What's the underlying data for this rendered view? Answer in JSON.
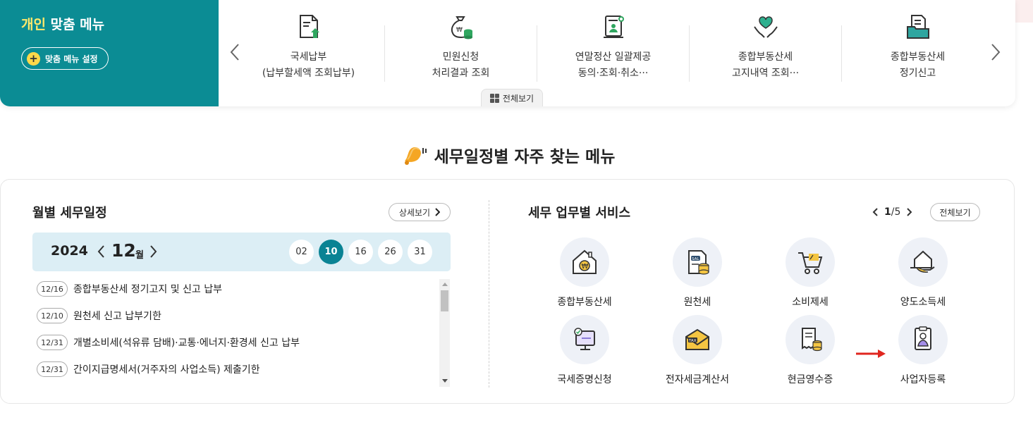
{
  "custom_menu": {
    "title_highlight": "개인",
    "title_rest": " 맞춤 메뉴",
    "setting_button": "맞춤 메뉴 설정",
    "items": [
      {
        "line1": "국세납부",
        "line2": "(납부할세액 조회납부)",
        "icon": "tax-payment-icon"
      },
      {
        "line1": "민원신청",
        "line2": "처리결과 조회",
        "icon": "money-bag-icon"
      },
      {
        "line1": "연말정산 일괄제공",
        "line2": "동의·조회·취소···",
        "icon": "year-end-settlement-icon"
      },
      {
        "line1": "종합부동산세",
        "line2": "고지내역 조회···",
        "icon": "heart-hands-icon"
      },
      {
        "line1": "종합부동산세",
        "line2": "정기신고",
        "icon": "document-folder-icon"
      }
    ],
    "view_all": "전체보기"
  },
  "section_title": "세무일정별 자주 찾는 메뉴",
  "monthly": {
    "title": "월별 세무일정",
    "detail_button": "상세보기",
    "year": "2024",
    "month": "12",
    "month_unit": "월",
    "days": [
      "02",
      "10",
      "16",
      "26",
      "31"
    ],
    "active_day": "10",
    "schedule": [
      {
        "date": "12/16",
        "text": "종합부동산세 정기고지 및 신고 납부"
      },
      {
        "date": "12/10",
        "text": "원천세 신고 납부기한"
      },
      {
        "date": "12/31",
        "text": "개별소비세(석유류 담배)·교통·에너지·환경세 신고 납부"
      },
      {
        "date": "12/31",
        "text": "간이지급명세서(거주자의 사업소득) 제출기한"
      }
    ]
  },
  "services": {
    "title": "세무 업무별 서비스",
    "page_current": "1",
    "page_sep": "/",
    "page_total": "5",
    "view_all": "전체보기",
    "items": [
      {
        "label": "종합부동산세",
        "icon": "house-won-icon"
      },
      {
        "label": "원천세",
        "icon": "salary-coins-icon"
      },
      {
        "label": "소비제세",
        "icon": "shopping-cart-icon"
      },
      {
        "label": "양도소득세",
        "icon": "hand-house-icon"
      },
      {
        "label": "국세증명신청",
        "icon": "certificate-monitor-icon"
      },
      {
        "label": "전자세금계산서",
        "icon": "tax-envelope-icon"
      },
      {
        "label": "현금영수증",
        "icon": "receipt-coins-icon"
      },
      {
        "label": "사업자등록",
        "icon": "business-registration-icon"
      }
    ]
  },
  "colors": {
    "teal": "#0b8c94",
    "active_day": "#0a8394",
    "highlight_yellow": "#ffe96b",
    "arrow_red": "#e0261f"
  }
}
